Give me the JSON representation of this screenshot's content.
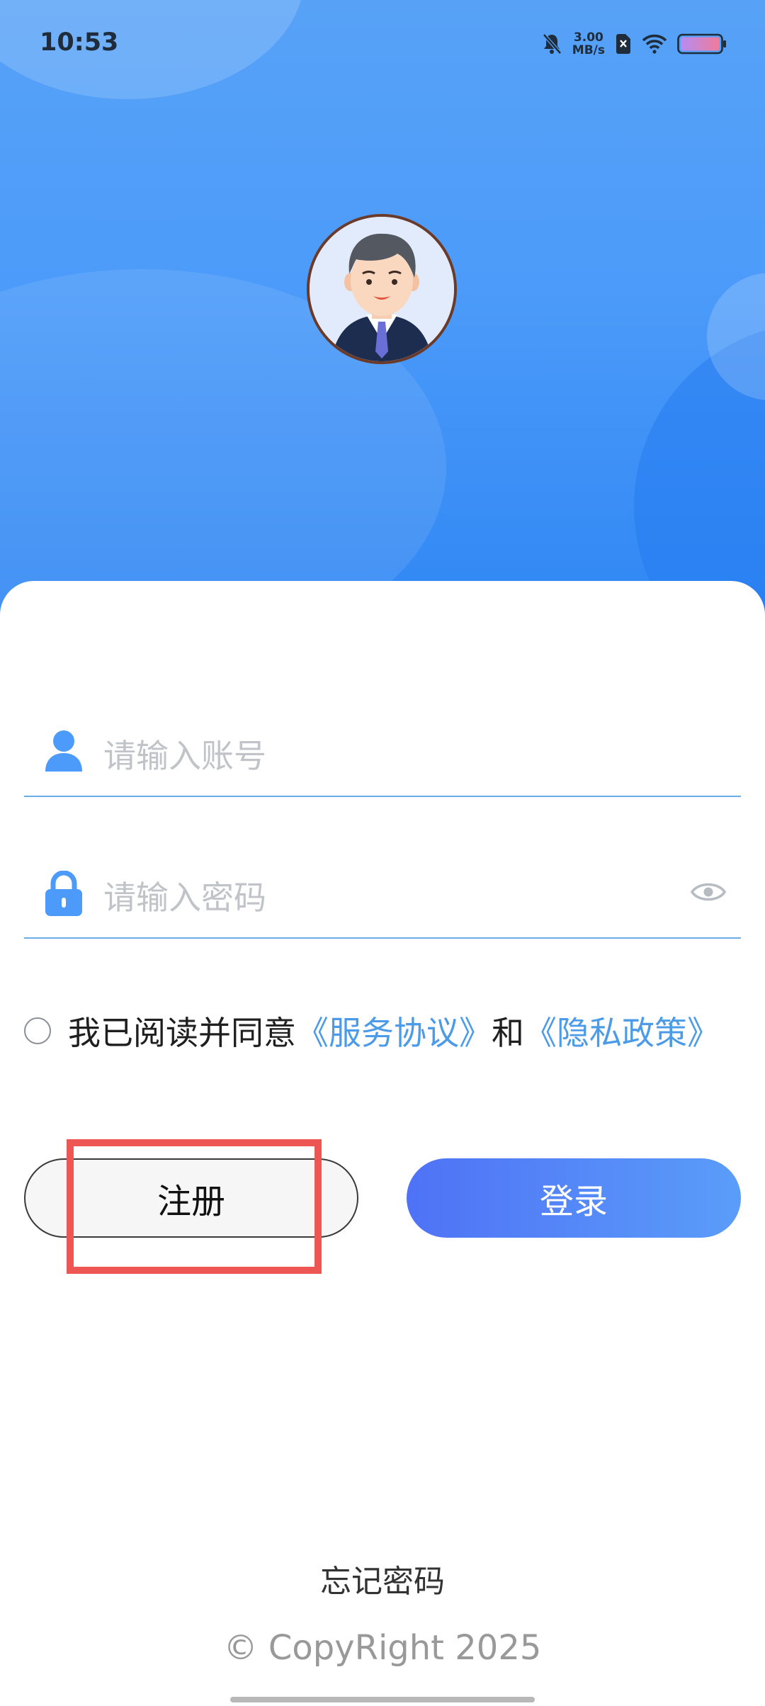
{
  "status_bar": {
    "time": "10:53",
    "network_speed_value": "3.00",
    "network_speed_unit": "MB/s",
    "icons": [
      "bell-muted-icon",
      "sim-x-icon",
      "wifi-icon",
      "battery-icon"
    ]
  },
  "header": {
    "avatar_icon": "user-avatar"
  },
  "form": {
    "account_placeholder": "请输入账号",
    "password_placeholder": "请输入密码",
    "icons": [
      "user-icon",
      "lock-icon",
      "eye-icon"
    ]
  },
  "agreement": {
    "prefix": "我已阅读并同意",
    "service": "《服务协议》",
    "and": "和",
    "privacy": "《隐私政策》",
    "checked": false
  },
  "actions": {
    "register_label": "注册",
    "login_label": "登录"
  },
  "footer": {
    "forgot_password": "忘记密码",
    "copyright": "© CopyRight 2025"
  },
  "colors": {
    "primary": "#4c9bfa",
    "link": "#4c9be8",
    "highlight": "#ee5653"
  }
}
